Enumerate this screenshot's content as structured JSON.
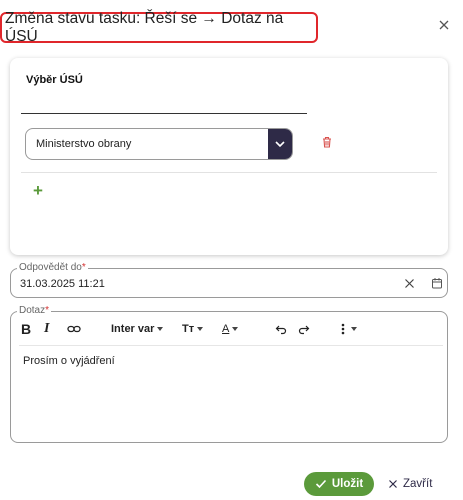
{
  "dialog": {
    "title": "Změna stavu tasku: Řeší se → Dotaz na ÚSÚ"
  },
  "usu_card": {
    "title": "Výběr ÚSÚ",
    "selected_value": "Ministerstvo obrany",
    "add_label": "+"
  },
  "deadline": {
    "label": "Odpovědět do",
    "required_mark": "*",
    "value": "31.03.2025 11:21"
  },
  "question": {
    "label": "Dotaz",
    "required_mark": "*",
    "toolbar": {
      "bold": "B",
      "italic": "I",
      "font": "Inter var",
      "size": "Tт",
      "color": "A"
    },
    "text": "Prosím o vyjádření"
  },
  "footer": {
    "save_label": "Uložit",
    "cancel_label": "Zavřít"
  },
  "colors": {
    "accent_green": "#5b9a3b",
    "dark_navy": "#2e2a47",
    "highlight_red": "#e0262b",
    "delete_red": "#d9534f"
  },
  "icons": [
    "close-icon",
    "chevron-down-icon",
    "trash-icon",
    "plus-icon",
    "clear-icon",
    "calendar-icon",
    "link-icon",
    "undo-icon",
    "redo-icon",
    "more-icon",
    "check-icon"
  ]
}
